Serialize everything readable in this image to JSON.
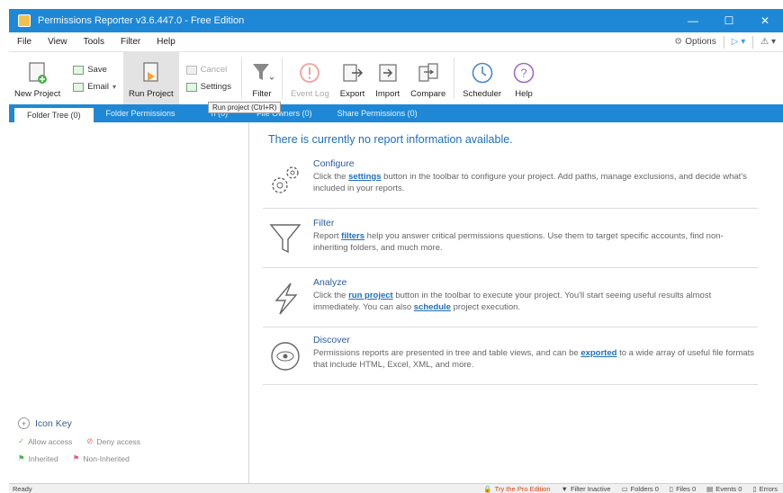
{
  "window": {
    "title": "Permissions Reporter v3.6.447.0 - Free Edition",
    "minimize": "—",
    "maximize": "☐",
    "close": "✕"
  },
  "menu": {
    "items": [
      "File",
      "View",
      "Tools",
      "Filter",
      "Help"
    ],
    "options_label": "Options"
  },
  "ribbon": {
    "new_project": "New Project",
    "save": "Save",
    "email": "Email",
    "run_project": "Run Project",
    "cancel": "Cancel",
    "settings": "Settings",
    "filter": "Filter",
    "event_log": "Event Log",
    "export": "Export",
    "import": "Import",
    "compare": "Compare",
    "scheduler": "Scheduler",
    "help": "Help"
  },
  "tabs": [
    {
      "label": "Folder Tree (0)"
    },
    {
      "label": "Folder Permissions"
    },
    {
      "label": "n (0)"
    },
    {
      "label": "File Owners (0)"
    },
    {
      "label": "Share Permissions (0)"
    }
  ],
  "tooltip": "Run project (Ctrl+R)",
  "main": {
    "no_data": "There is currently no report information available.",
    "cards": [
      {
        "title": "Configure",
        "pre": "Click the ",
        "link": "settings",
        "post": " button in the toolbar to configure your project. Add paths, manage exclusions, and decide what's included in your reports."
      },
      {
        "title": "Filter",
        "pre": "Report ",
        "link": "filters",
        "post": " help you answer critical permissions questions. Use them to target specific accounts, find non-inheriting folders, and much more."
      },
      {
        "title": "Analyze",
        "pre": "Click the ",
        "link": "run project",
        "post": " button in the toolbar to execute your project. You'll start seeing useful results almost immediately. You can also ",
        "link2": "schedule",
        "post2": " project execution."
      },
      {
        "title": "Discover",
        "pre": "Permissions reports are presented in tree and table views, and can be ",
        "link": "exported",
        "post": " to a wide array of useful file formats that include HTML, Excel, XML, and more."
      }
    ]
  },
  "iconkey": {
    "title": "Icon Key",
    "allow": "Allow access",
    "deny": "Deny access",
    "inherited": "Inherited",
    "noninherited": "Non-Inherited"
  },
  "status": {
    "ready": "Ready",
    "pro": "Try the Pro Edition",
    "filter": "Filter Inactive",
    "folders": "Folders 0",
    "files": "Files 0",
    "events": "Events 0",
    "errors": "Errors"
  },
  "colors": {
    "accent": "#1e88d6",
    "link": "#1e6fb8",
    "title": "#2a5d9f"
  }
}
